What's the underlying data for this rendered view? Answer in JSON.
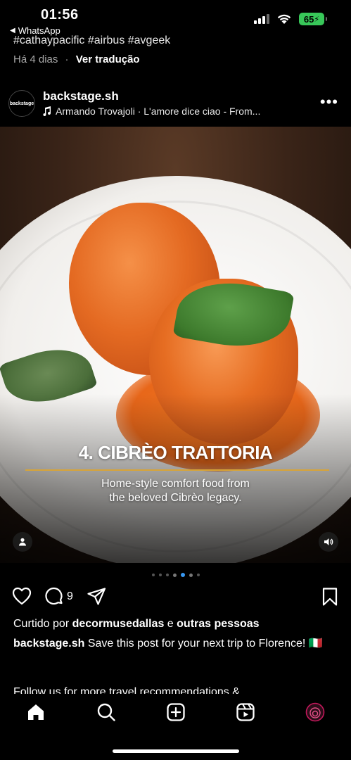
{
  "status_bar": {
    "time": "01:56",
    "back_app": "WhatsApp",
    "battery": "65",
    "battery_color": "#38c759"
  },
  "previous_post": {
    "hashtags": "#cathaypacific #airbus #avgeek",
    "age": "Há 4 dias",
    "separator": "·",
    "translate": "Ver tradução"
  },
  "post": {
    "avatar_text": "backstage",
    "username": "backstage.sh",
    "audio_icon": "music-note-icon",
    "audio": "Armando Trovajoli · L'amore dice ciao - From...",
    "more_icon": "more-options-icon",
    "more": "•••"
  },
  "photo": {
    "title": "4. CIBRÈO TRATTORIA",
    "subtitle_line1": "Home-style comfort food from",
    "subtitle_line2": "the beloved Cibrèo legacy.",
    "line_color": "#d8a437"
  },
  "carousel": {
    "total": 7,
    "current": 5,
    "active_color": "#3797f0"
  },
  "actions": {
    "comment_count": "9",
    "like_icon": "heart-icon",
    "comment_icon": "comment-icon",
    "share_icon": "share-icon",
    "save_icon": "bookmark-icon"
  },
  "caption": {
    "liked_prefix": "Curtido por",
    "liked_user": "decormusedallas",
    "liked_and": "e",
    "liked_others": "outras pessoas",
    "author": "backstage.sh",
    "text": "Save this post for your next trip to Florence! 🇮🇹",
    "next_line": "Follow us for more travel recommendations &"
  },
  "nav": {
    "items": [
      "home-icon",
      "search-icon",
      "create-icon",
      "reels-icon",
      "profile-icon"
    ]
  }
}
